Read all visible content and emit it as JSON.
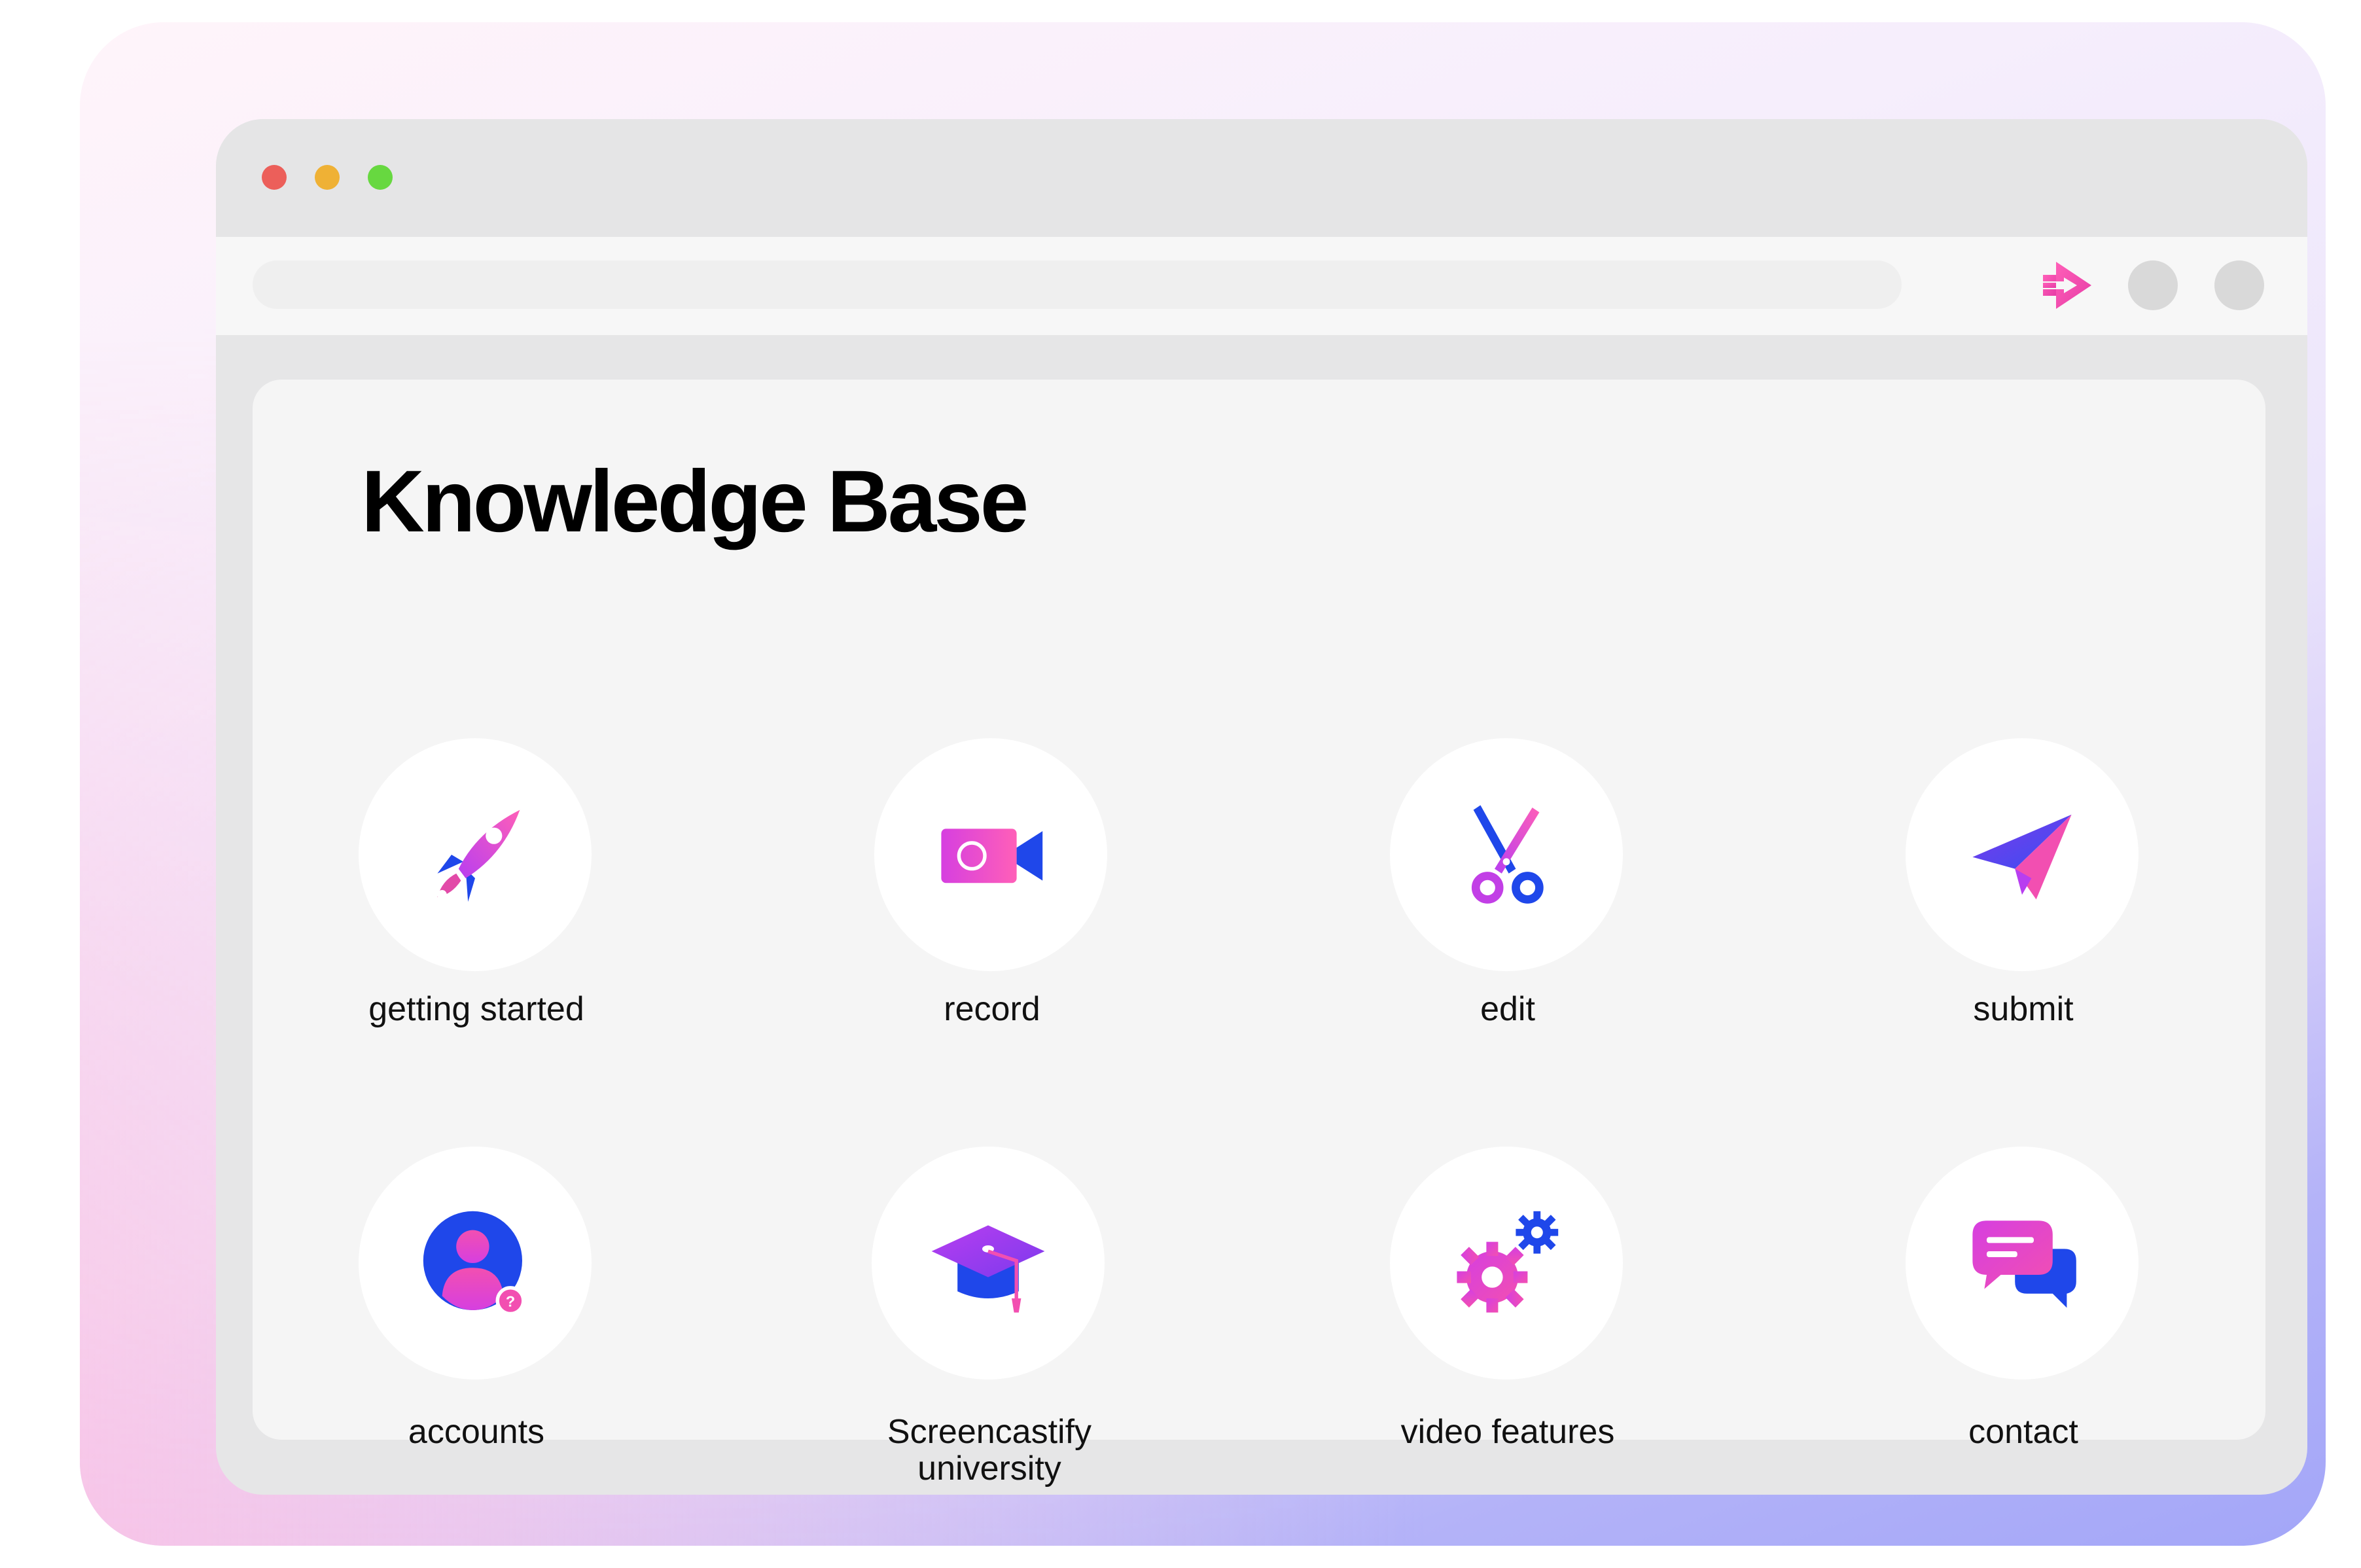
{
  "window": {
    "title": "Knowledge Base",
    "traffic_lights": [
      {
        "name": "close",
        "color": "#ec5f5a"
      },
      {
        "name": "minimize",
        "color": "#efb135"
      },
      {
        "name": "maximize",
        "color": "#67d840"
      }
    ]
  },
  "toolbar": {
    "extension_icon": "screencastify-logo-icon",
    "buttons": [
      "profile",
      "menu"
    ]
  },
  "categories": [
    {
      "label": "getting started",
      "icon": "rocket-icon"
    },
    {
      "label": "record",
      "icon": "video-camera-icon"
    },
    {
      "label": "edit",
      "icon": "scissors-icon"
    },
    {
      "label": "submit",
      "icon": "paper-plane-icon"
    },
    {
      "label": "accounts",
      "icon": "user-account-icon"
    },
    {
      "label": "Screencastify\nuniversity",
      "icon": "graduation-cap-icon"
    },
    {
      "label": "video features",
      "icon": "gears-icon"
    },
    {
      "label": "contact",
      "icon": "chat-bubbles-icon"
    }
  ],
  "colors": {
    "pink": "#f24fb1",
    "magenta": "#b83ef0",
    "blue": "#1f47ea",
    "violet": "#7c3aed"
  }
}
